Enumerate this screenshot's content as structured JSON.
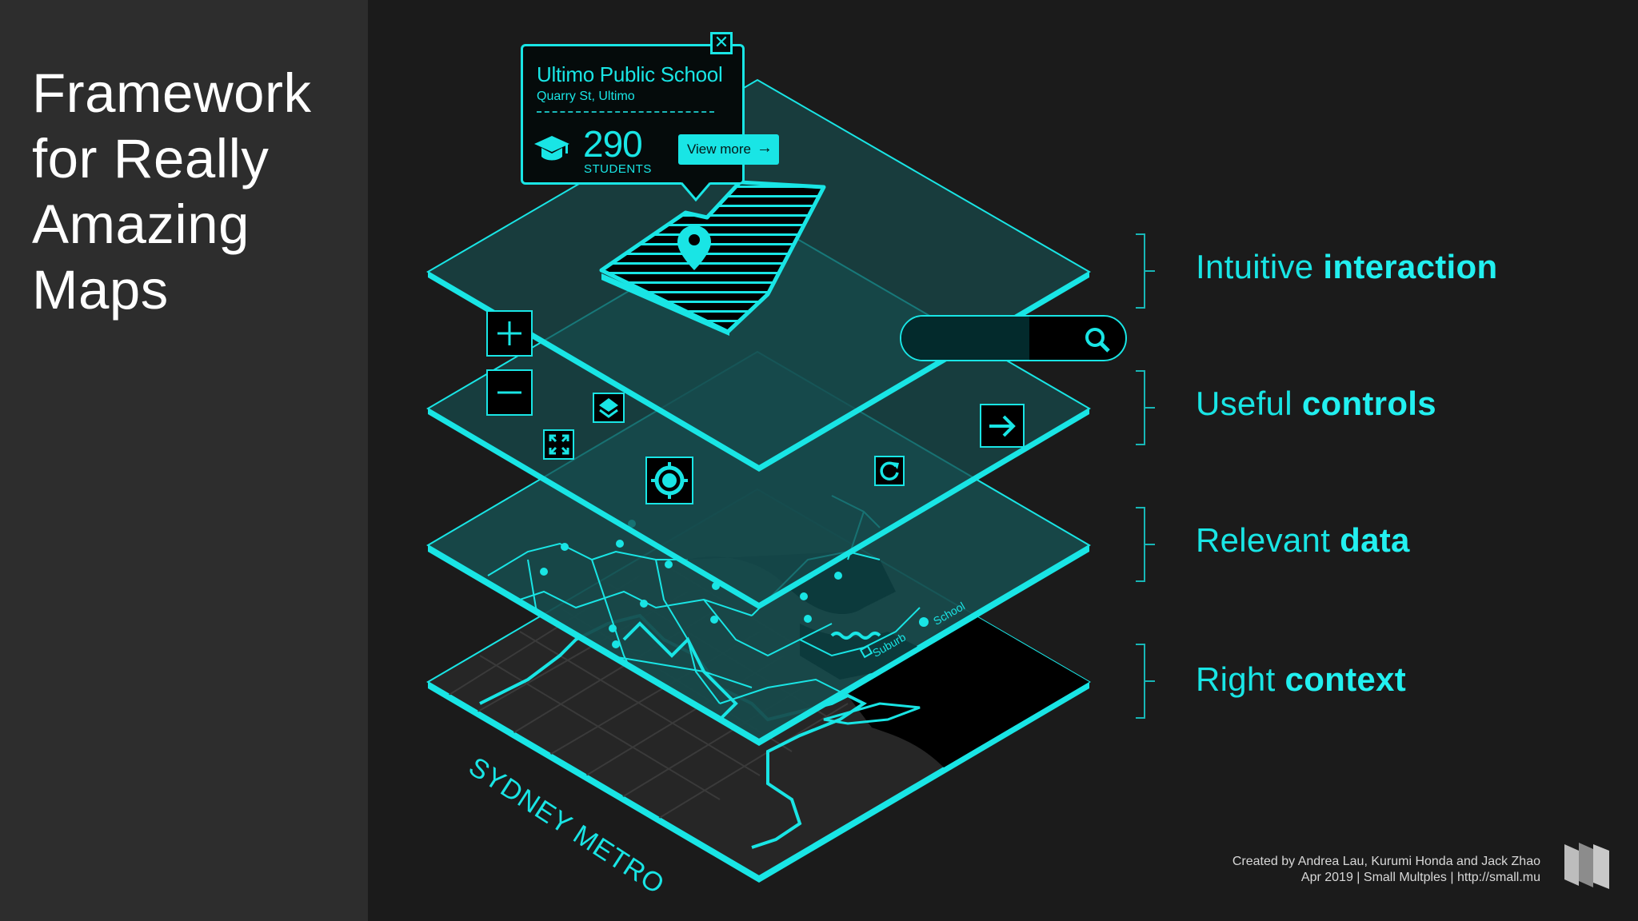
{
  "sidebar": {
    "title_lines": [
      "Framework",
      "for Really",
      "Amazing",
      "Maps"
    ]
  },
  "popup": {
    "name": "Ultimo Public School",
    "address": "Quarry St, Ultimo",
    "count": "290",
    "unit": "STUDENTS",
    "icon": "graduation-cap-icon",
    "button_label": "View more",
    "button_icon": "arrow-right-icon",
    "close_icon": "close-icon",
    "close_glyph": "✕",
    "arrow_glyph": "→"
  },
  "controls": {
    "zoom_in": "plus-icon",
    "zoom_out": "minus-icon",
    "layers": "layers-icon",
    "fullscreen": "fullscreen-icon",
    "locate": "locate-icon",
    "refresh": "refresh-icon",
    "next": "arrow-right-icon",
    "search": "search-icon"
  },
  "map_labels": {
    "school": "School",
    "suburb": "Suburb",
    "region": "SYDNEY METRO"
  },
  "layers": [
    {
      "regular": "Intuitive ",
      "bold": "interaction"
    },
    {
      "regular": "Useful ",
      "bold": "controls"
    },
    {
      "regular": "Relevant ",
      "bold": "data"
    },
    {
      "regular": "Right ",
      "bold": "context"
    }
  ],
  "credits": {
    "line1": "Created by Andrea Lau, Kurumi Honda and Jack Zhao",
    "line2": "Apr 2019 | Small Multples | http://small.mu"
  },
  "colors": {
    "accent": "#19e5e5",
    "layer_fill": "#174a4b",
    "layer_overlap": "#136c6c",
    "background": "#1b1b1b",
    "sidebar": "#2d2d2d"
  }
}
